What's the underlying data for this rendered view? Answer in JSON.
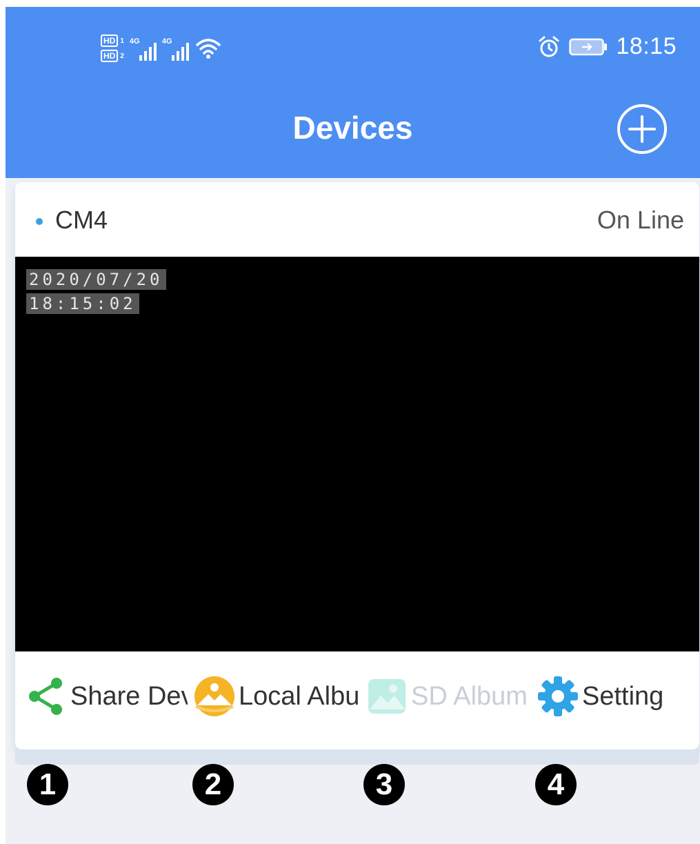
{
  "status_bar": {
    "sim1_label": "HD",
    "sim1_num": "1",
    "sim2_label": "HD",
    "sim2_num": "2",
    "network1": "4G",
    "network2": "4G",
    "time": "18:15",
    "icons": [
      "wifi-icon",
      "alarm-icon",
      "battery-icon"
    ]
  },
  "header": {
    "title": "Devices",
    "add_icon": "plus-circle-icon",
    "background": "#4d8ef2"
  },
  "device": {
    "name": "CM4",
    "status": "On Line",
    "status_dot_color": "#3aa0e4",
    "osd_date": "2020/07/20",
    "osd_time": "18:15:02"
  },
  "actions": [
    {
      "label": "Share Dev",
      "icon": "share-icon",
      "enabled": true
    },
    {
      "label": "Local Albu",
      "icon": "local-album-icon",
      "enabled": true
    },
    {
      "label": "SD Album",
      "icon": "sd-album-icon",
      "enabled": false
    },
    {
      "label": "Setting",
      "icon": "gear-icon",
      "enabled": true
    }
  ],
  "markers": [
    "1",
    "2",
    "3",
    "4"
  ]
}
